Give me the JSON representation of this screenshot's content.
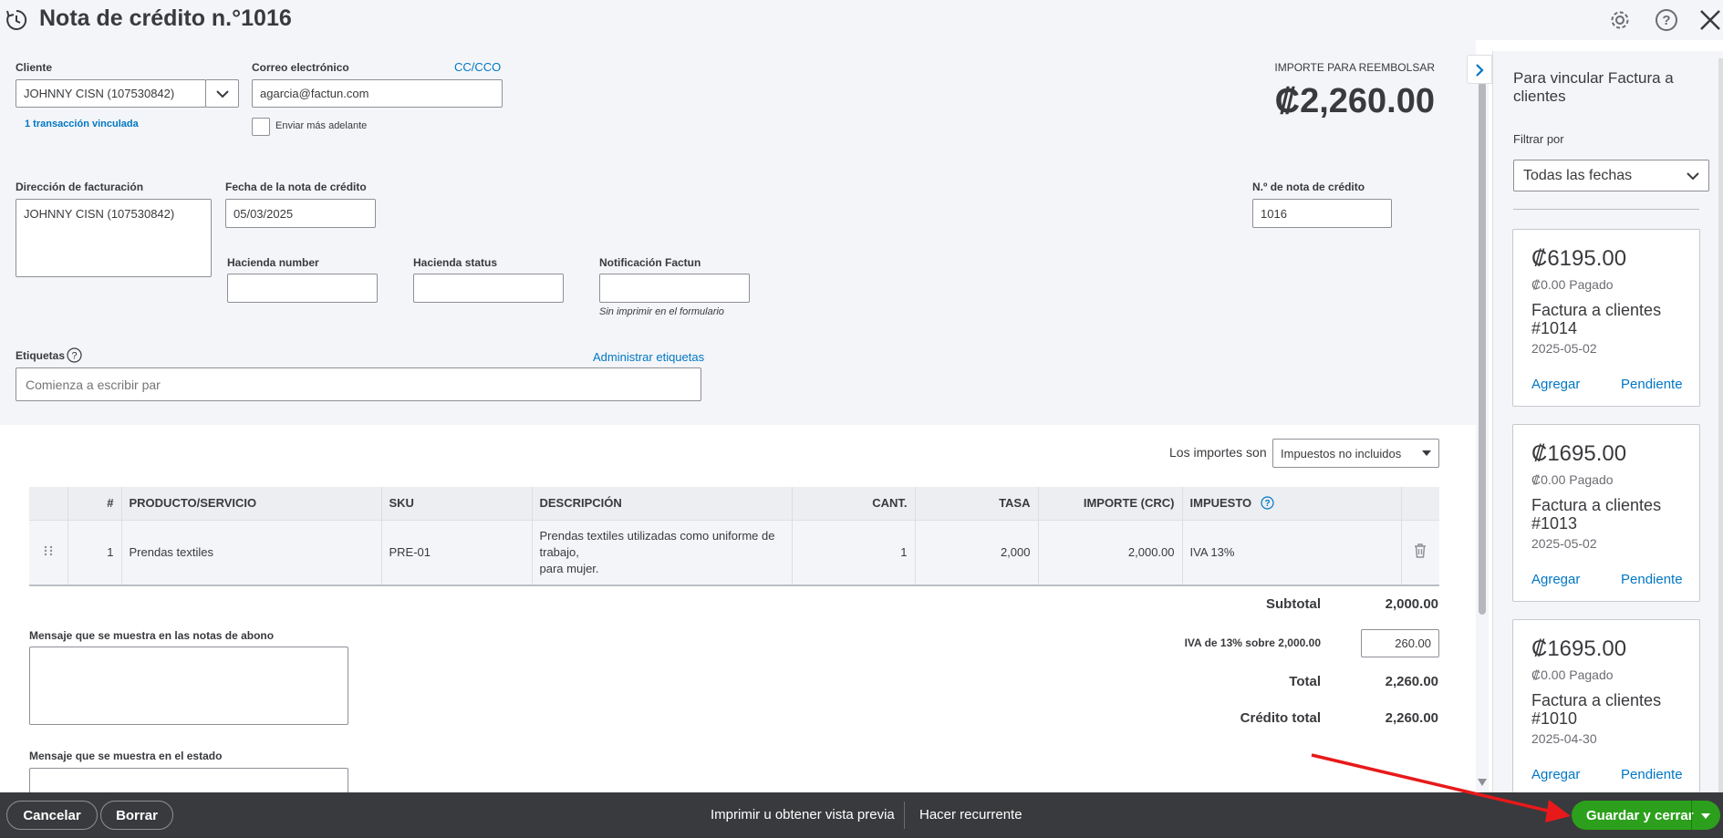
{
  "header": {
    "title": "Nota de crédito n.°1016",
    "icons": [
      "history-icon",
      "gear-icon",
      "help-icon",
      "close-icon"
    ]
  },
  "customer": {
    "label": "Cliente",
    "value": "JOHNNY CISN (107530842)",
    "linked": "1 transacción vinculada"
  },
  "email": {
    "label": "Correo electrónico",
    "ccbcc": "CC/CCO",
    "value": "agarcia@factun.com",
    "send_later": "Enviar más adelante"
  },
  "refund": {
    "label": "IMPORTE PARA REEMBOLSAR",
    "amount": "₡2,260.00"
  },
  "billing": {
    "label": "Dirección de facturación",
    "value": "JOHNNY CISN (107530842)"
  },
  "credit_date": {
    "label": "Fecha de la nota de crédito",
    "value": "05/03/2025"
  },
  "credit_no": {
    "label": "N.º de nota de crédito",
    "value": "1016"
  },
  "hacienda_number": {
    "label": "Hacienda number",
    "value": ""
  },
  "hacienda_status": {
    "label": "Hacienda status",
    "value": ""
  },
  "notificacion": {
    "label": "Notificación Factun",
    "value": "",
    "hint": "Sin imprimir en el formulario"
  },
  "tags": {
    "label": "Etiquetas",
    "manage": "Administrar etiquetas",
    "placeholder": "Comienza a escribir par"
  },
  "amounts": {
    "label": "Los importes son",
    "value": "Impuestos no incluidos"
  },
  "table": {
    "headers": [
      "#",
      "PRODUCTO/SERVICIO",
      "SKU",
      "DESCRIPCIÓN",
      "CANT.",
      "TASA",
      "IMPORTE (CRC)",
      "IMPUESTO"
    ],
    "row": {
      "num": "1",
      "product": "Prendas textiles",
      "sku": "PRE-01",
      "desc1": "Prendas textiles utilizadas como uniforme de",
      "desc2": "trabajo,",
      "desc3": "para mujer.",
      "qty": "1",
      "rate": "2,000",
      "amount": "2,000.00",
      "tax": "IVA 13%"
    }
  },
  "totals": {
    "subtotal_label": "Subtotal",
    "subtotal_value": "2,000.00",
    "iva_label": "IVA de 13% sobre 2,000.00",
    "iva_value": "260.00",
    "total_label": "Total",
    "total_value": "2,260.00",
    "credit_label": "Crédito total",
    "credit_value": "2,260.00"
  },
  "messages": {
    "notes_label": "Mensaje que se muestra en las notas de abono",
    "statement_label": "Mensaje que se muestra en el estado"
  },
  "panel": {
    "title": "Para vincular Factura a clientes",
    "filter_label": "Filtrar por",
    "filter_value": "Todas las fechas",
    "cards": [
      {
        "amount": "₡6195.00",
        "paid": "₡0.00 Pagado",
        "invoice": "Factura a clientes #1014",
        "date": "2025-05-02",
        "add": "Agregar",
        "pending": "Pendiente"
      },
      {
        "amount": "₡1695.00",
        "paid": "₡0.00 Pagado",
        "invoice": "Factura a clientes #1013",
        "date": "2025-05-02",
        "add": "Agregar",
        "pending": "Pendiente"
      },
      {
        "amount": "₡1695.00",
        "paid": "₡0.00 Pagado",
        "invoice": "Factura a clientes #1010",
        "date": "2025-04-30",
        "add": "Agregar",
        "pending": "Pendiente"
      }
    ]
  },
  "footer": {
    "cancel": "Cancelar",
    "delete": "Borrar",
    "print": "Imprimir u obtener vista previa",
    "recurring": "Hacer recurrente",
    "save": "Guardar y cerrar"
  },
  "colors": {
    "accent": "#0077c5",
    "save_green": "#2ca01c",
    "footer_dark": "#393a3d",
    "annotation_arrow": "#e8191a"
  }
}
